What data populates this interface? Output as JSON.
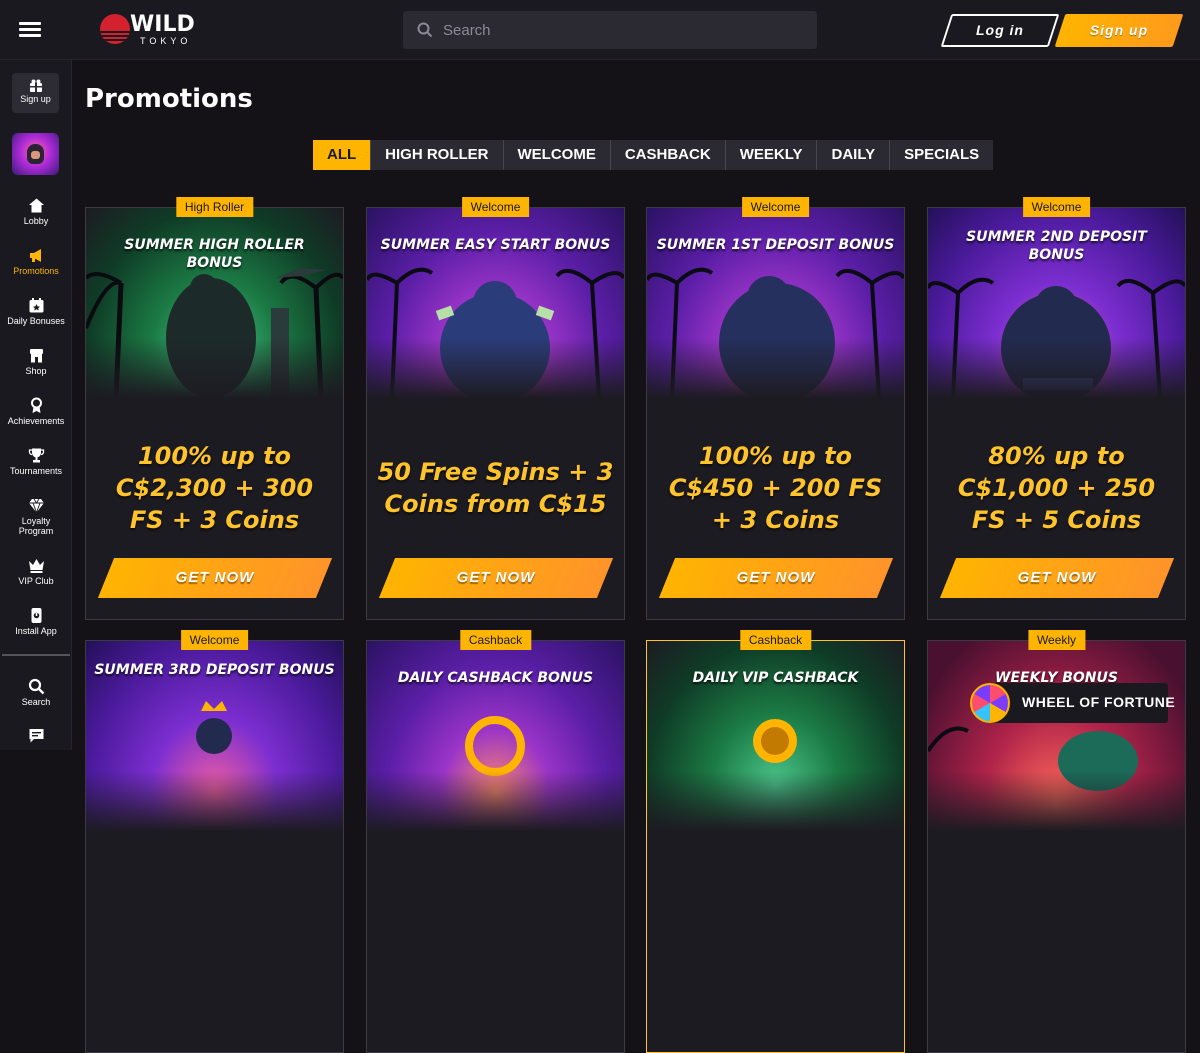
{
  "header": {
    "logo_top": "WILD",
    "logo_bottom": "TOKYO",
    "search_placeholder": "Search",
    "login_label": "Log in",
    "signup_label": "Sign up"
  },
  "sidebar": {
    "signup_label": "Sign up",
    "items": [
      {
        "label": "Lobby",
        "icon": "home-icon"
      },
      {
        "label": "Promotions",
        "icon": "megaphone-icon",
        "active": true
      },
      {
        "label": "Daily Bonuses",
        "icon": "gift-icon"
      },
      {
        "label": "Shop",
        "icon": "shop-icon"
      },
      {
        "label": "Achievements",
        "icon": "medal-icon"
      },
      {
        "label": "Tournaments",
        "icon": "trophy-icon"
      },
      {
        "label": "Loyalty Program",
        "icon": "diamond-icon"
      },
      {
        "label": "VIP Club",
        "icon": "crown-icon"
      },
      {
        "label": "Install App",
        "icon": "phone-icon"
      },
      {
        "label": "Search",
        "icon": "search-icon"
      },
      {
        "label": "",
        "icon": "chat-icon"
      }
    ]
  },
  "page": {
    "title": "Promotions",
    "tabs": [
      "ALL",
      "HIGH ROLLER",
      "WELCOME",
      "CASHBACK",
      "WEEKLY",
      "DAILY",
      "SPECIALS"
    ],
    "active_tab": "ALL"
  },
  "cards": [
    {
      "badge": "High Roller",
      "title": "SUMMER HIGH ROLLER BONUS",
      "offer": "100% up to C$2,300 + 300 FS + 3 Coins",
      "button": "GET NOW"
    },
    {
      "badge": "Welcome",
      "title": "SUMMER EASY START BONUS",
      "offer": "50 Free Spins + 3 Coins from C$15",
      "button": "GET NOW"
    },
    {
      "badge": "Welcome",
      "title": "SUMMER 1ST DEPOSIT BONUS",
      "offer": "100% up to C$450 + 200 FS + 3 Coins",
      "button": "GET NOW"
    },
    {
      "badge": "Welcome",
      "title": "SUMMER 2ND DEPOSIT BONUS",
      "offer": "80% up to C$1,000 + 250 FS + 5 Coins",
      "button": "GET NOW"
    },
    {
      "badge": "Welcome",
      "title": "SUMMER 3RD DEPOSIT BONUS"
    },
    {
      "badge": "Cashback",
      "title": "DAILY CASHBACK BONUS"
    },
    {
      "badge": "Cashback",
      "title": "DAILY VIP CASHBACK"
    },
    {
      "badge": "Weekly",
      "title": "WEEKLY BONUS"
    }
  ],
  "wheel_widget": {
    "label": "WHEEL OF FORTUNE"
  },
  "colors": {
    "accent": "#ffb400",
    "background": "#141217",
    "panel": "#1b1920"
  }
}
